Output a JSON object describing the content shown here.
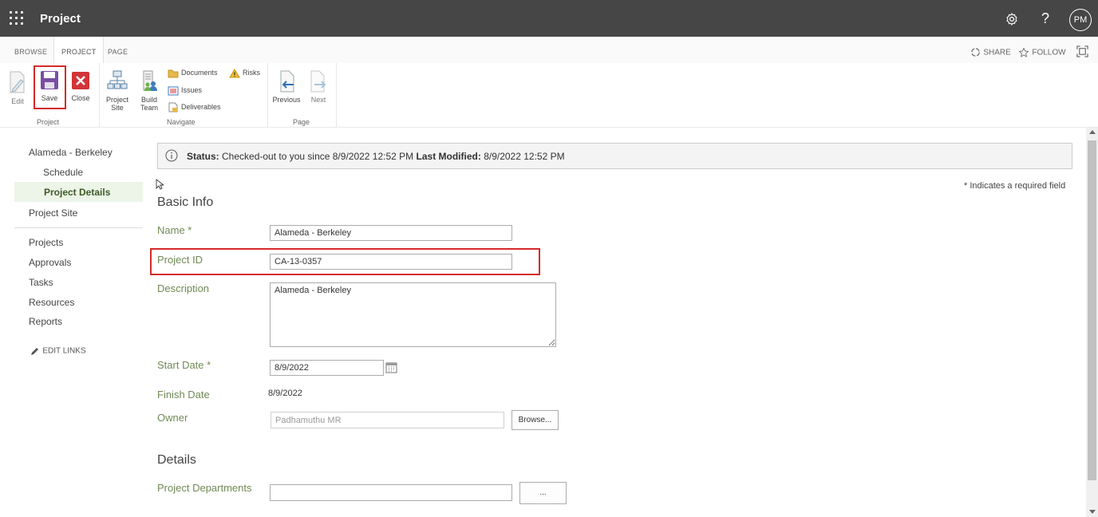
{
  "suitebar": {
    "title": "Project",
    "avatar": "PM",
    "help": "?"
  },
  "tabs": [
    {
      "label": "BROWSE"
    },
    {
      "label": "PROJECT"
    },
    {
      "label": "PAGE"
    }
  ],
  "toplinks": {
    "share": "SHARE",
    "follow": "FOLLOW"
  },
  "ribbon": {
    "edit": "Edit",
    "save": "Save",
    "close": "Close",
    "group_project": "Project",
    "project_site_1": "Project",
    "project_site_2": "Site",
    "build_team_1": "Build",
    "build_team_2": "Team",
    "documents": "Documents",
    "risks": "Risks",
    "issues": "Issues",
    "deliverables": "Deliverables",
    "group_navigate": "Navigate",
    "previous": "Previous",
    "next": "Next",
    "group_page": "Page"
  },
  "nav": {
    "project_name": "Alameda - Berkeley",
    "schedule": "Schedule",
    "project_details": "Project Details",
    "project_site": "Project Site",
    "projects": "Projects",
    "approvals": "Approvals",
    "tasks": "Tasks",
    "resources": "Resources",
    "reports": "Reports",
    "edit_links": "EDIT LINKS"
  },
  "status": {
    "status_label": "Status:",
    "status_value": "Checked-out to you since 8/9/2022 12:52 PM",
    "modified_label": "Last Modified:",
    "modified_value": "8/9/2022 12:52 PM"
  },
  "form": {
    "required_note": "* Indicates a required field",
    "basic_info": "Basic Info",
    "name_label": "Name *",
    "name_value": "Alameda - Berkeley",
    "project_id_label": "Project ID",
    "project_id_value": "CA-13-0357",
    "description_label": "Description",
    "description_value": "Alameda - Berkeley",
    "start_date_label": "Start Date *",
    "start_date_value": "8/9/2022",
    "finish_date_label": "Finish Date",
    "finish_date_value": "8/9/2022",
    "owner_label": "Owner",
    "owner_value": "Padhamuthu MR",
    "browse_button": "Browse...",
    "details": "Details",
    "departments_label": "Project Departments",
    "departments_value": "",
    "departments_button": "..."
  },
  "colors": {
    "suitebar_bg": "#464646",
    "label_green": "#6f8a54",
    "highlight_red": "#d42a2a",
    "nav_selected_bg": "#edf4e8"
  }
}
